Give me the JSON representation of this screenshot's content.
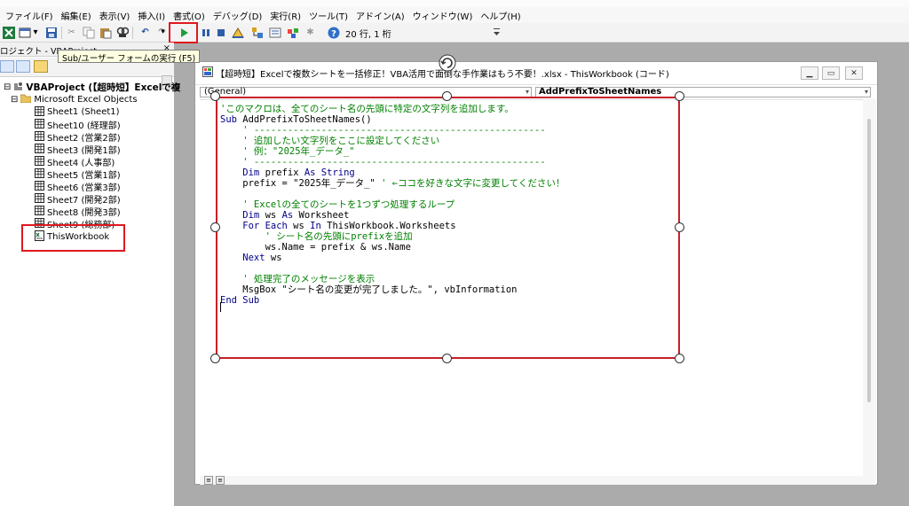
{
  "menu": [
    "ファイル(F)",
    "編集(E)",
    "表示(V)",
    "挿入(I)",
    "書式(O)",
    "デバッグ(D)",
    "実行(R)",
    "ツール(T)",
    "アドイン(A)",
    "ウィンドウ(W)",
    "ヘルプ(H)"
  ],
  "toolbar": {
    "status": "20 行, 1 桁",
    "tooltip": "Sub/ユーザー フォームの実行 (F5)"
  },
  "project": {
    "title": "ロジェクト - VBAProject",
    "close": "×",
    "root": "VBAProject (【超時短】Excelで複",
    "folder": "Microsoft Excel Objects",
    "sheets": [
      "Sheet1 (Sheet1)",
      "Sheet10 (経理部)",
      "Sheet2 (営業2部)",
      "Sheet3 (開発1部)",
      "Sheet4 (人事部)",
      "Sheet5 (営業1部)",
      "Sheet6 (営業3部)",
      "Sheet7 (開発2部)",
      "Sheet8 (開発3部)",
      "Sheet9 (総務部)"
    ],
    "workbook": "ThisWorkbook"
  },
  "code_window": {
    "title": "【超時短】Excelで複数シートを一括修正！VBA活用で面倒な手作業はもう不要！.xlsx - ThisWorkbook (コード)",
    "object_combo": "(General)",
    "proc_combo": "AddPrefixToSheetNames",
    "lines": [
      {
        "parts": [
          {
            "t": "'このマクロは、全てのシート名の先頭に特定の文字列を追加します。",
            "c": "cm"
          }
        ]
      },
      {
        "parts": [
          {
            "t": "Sub",
            "c": "kw"
          },
          {
            "t": " AddPrefixToSheetNames()",
            "c": ""
          }
        ]
      },
      {
        "parts": [
          {
            "t": "    ' ----------------------------------------------------",
            "c": "cm"
          }
        ]
      },
      {
        "parts": [
          {
            "t": "    ' 追加したい文字列をここに設定してください",
            "c": "cm"
          }
        ]
      },
      {
        "parts": [
          {
            "t": "    ' 例：\"2025年_データ_\"",
            "c": "cm"
          }
        ]
      },
      {
        "parts": [
          {
            "t": "    ' ----------------------------------------------------",
            "c": "cm"
          }
        ]
      },
      {
        "parts": [
          {
            "t": "    Dim",
            "c": "kw"
          },
          {
            "t": " prefix ",
            "c": ""
          },
          {
            "t": "As String",
            "c": "kw"
          }
        ]
      },
      {
        "parts": [
          {
            "t": "    prefix = \"2025年_データ_\" ",
            "c": ""
          },
          {
            "t": "' ←ココを好きな文字に変更してください！",
            "c": "cm"
          }
        ]
      },
      {
        "parts": [
          {
            "t": "",
            "c": ""
          }
        ]
      },
      {
        "parts": [
          {
            "t": "    ' Excelの全てのシートを1つずつ処理するループ",
            "c": "cm"
          }
        ]
      },
      {
        "parts": [
          {
            "t": "    Dim",
            "c": "kw"
          },
          {
            "t": " ws ",
            "c": ""
          },
          {
            "t": "As",
            "c": "kw"
          },
          {
            "t": " Worksheet",
            "c": ""
          }
        ]
      },
      {
        "parts": [
          {
            "t": "    For Each",
            "c": "kw"
          },
          {
            "t": " ws ",
            "c": ""
          },
          {
            "t": "In",
            "c": "kw"
          },
          {
            "t": " ThisWorkbook.Worksheets",
            "c": ""
          }
        ]
      },
      {
        "parts": [
          {
            "t": "        ' シート名の先頭にprefixを追加",
            "c": "cm"
          }
        ]
      },
      {
        "parts": [
          {
            "t": "        ws.Name = prefix & ws.Name",
            "c": ""
          }
        ]
      },
      {
        "parts": [
          {
            "t": "    Next",
            "c": "kw"
          },
          {
            "t": " ws",
            "c": ""
          }
        ]
      },
      {
        "parts": [
          {
            "t": "",
            "c": ""
          }
        ]
      },
      {
        "parts": [
          {
            "t": "    ' 処理完了のメッセージを表示",
            "c": "cm"
          }
        ]
      },
      {
        "parts": [
          {
            "t": "    MsgBox \"シート名の変更が完了しました。\", vbInformation",
            "c": ""
          }
        ]
      },
      {
        "parts": [
          {
            "t": "End Sub",
            "c": "kw"
          }
        ]
      }
    ]
  },
  "colors": {
    "highlight": "#e0181e",
    "comment": "#008000",
    "keyword": "#00008b"
  }
}
